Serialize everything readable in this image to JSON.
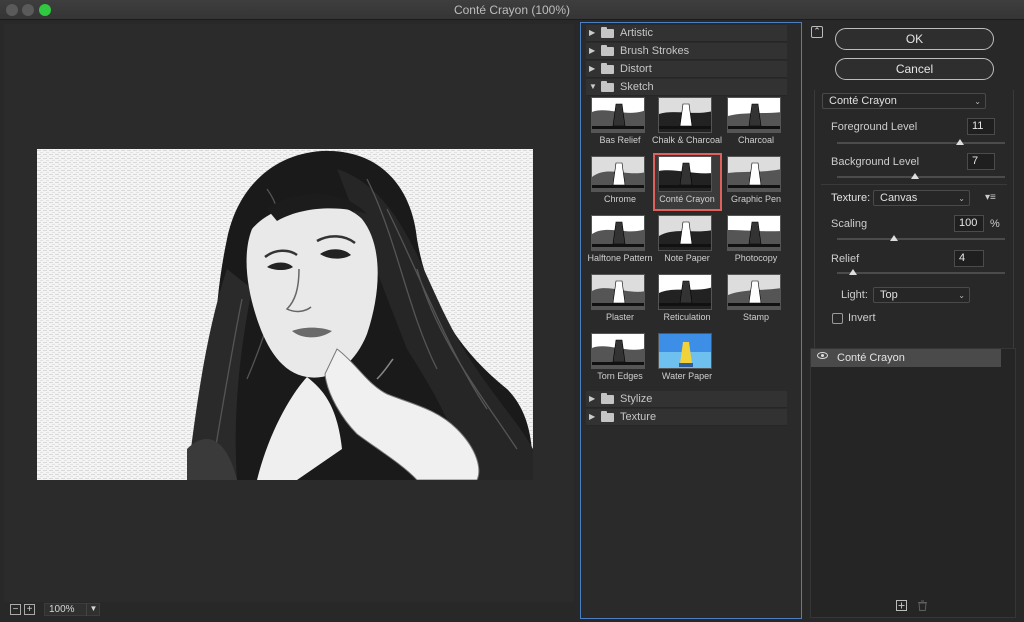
{
  "window": {
    "title": "Conté Crayon (100%)"
  },
  "status": {
    "zoom": "100%",
    "zoom_out": "−",
    "zoom_in": "+"
  },
  "gallery": {
    "folders_top": [
      {
        "label": "Artistic",
        "arrow": "▶"
      },
      {
        "label": "Brush Strokes",
        "arrow": "▶"
      },
      {
        "label": "Distort",
        "arrow": "▶"
      },
      {
        "label": "Sketch",
        "arrow": "▼"
      }
    ],
    "sketch_filters": [
      "Bas Relief",
      "Chalk & Charcoal",
      "Charcoal",
      "Chrome",
      "Conté Crayon",
      "Graphic Pen",
      "Halftone Pattern",
      "Note Paper",
      "Photocopy",
      "Plaster",
      "Reticulation",
      "Stamp",
      "Torn Edges",
      "Water Paper"
    ],
    "selected_filter": "Conté Crayon",
    "folders_bottom": [
      {
        "label": "Stylize",
        "arrow": "▶"
      },
      {
        "label": "Texture",
        "arrow": "▶"
      }
    ]
  },
  "buttons": {
    "ok": "OK",
    "cancel": "Cancel",
    "collapse": "⌃"
  },
  "settings": {
    "filter_select": "Conté Crayon",
    "foreground_label": "Foreground Level",
    "foreground_value": "11",
    "foreground_max": 15,
    "background_label": "Background Level",
    "background_value": "7",
    "background_max": 15,
    "texture_label": "Texture:",
    "texture_value": "Canvas",
    "texture_menu_icon": "▾≡",
    "scaling_label": "Scaling",
    "scaling_value": "100",
    "scaling_unit": "%",
    "relief_label": "Relief",
    "relief_value": "4",
    "light_label": "Light:",
    "light_value": "Top",
    "invert_label": "Invert",
    "invert_checked": false
  },
  "layers": [
    {
      "label": "Conté Crayon"
    }
  ],
  "icons": {
    "new_layer": "plus-square-icon",
    "delete_layer": "trash-icon",
    "visibility": "eye-icon",
    "folder": "folder-icon"
  },
  "colors": {
    "selection": "#e0605d",
    "panel_border": "#4a7fc1"
  }
}
